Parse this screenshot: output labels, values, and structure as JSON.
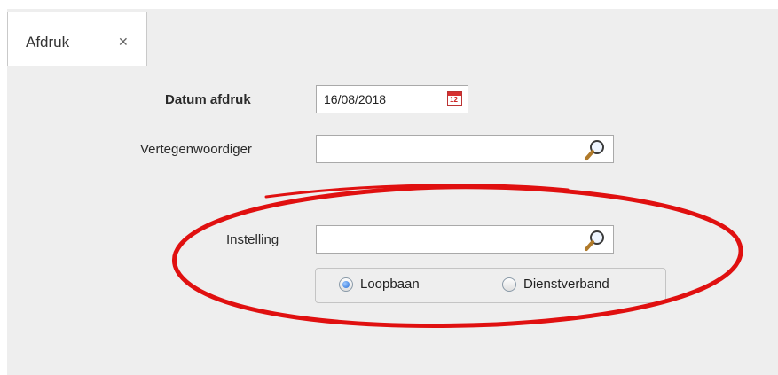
{
  "tab": {
    "label": "Afdruk",
    "close_glyph": "✕"
  },
  "form": {
    "datum_label": "Datum afdruk",
    "datum_value": "16/08/2018",
    "calendar_number": "12",
    "vertegenwoordiger_label": "Vertegenwoordiger",
    "vertegenwoordiger_value": "",
    "instelling_label": "Instelling",
    "instelling_value": "",
    "radio_options": [
      {
        "label": "Loopbaan",
        "checked": true
      },
      {
        "label": "Dienstverband",
        "checked": false
      }
    ]
  },
  "icons": {
    "calendar": "calendar-icon",
    "search": "magnifier-icon",
    "close": "close-icon"
  },
  "colors": {
    "annotation_ellipse": "#e01010",
    "panel_background": "#eeeeee",
    "radio_selected": "#2a6fd6"
  }
}
